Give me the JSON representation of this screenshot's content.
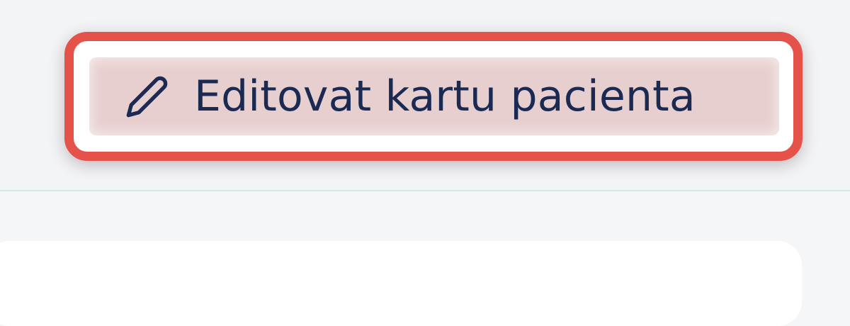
{
  "toolbar": {
    "edit_card_button": {
      "label": "Editovat kartu pacienta",
      "icon": "pencil-icon"
    }
  },
  "colors": {
    "highlight": "#e5524a",
    "button_fill": "#e8cfcf",
    "text": "#1b2a52",
    "background": "#f5f6f8",
    "divider": "#d7e7ea"
  }
}
